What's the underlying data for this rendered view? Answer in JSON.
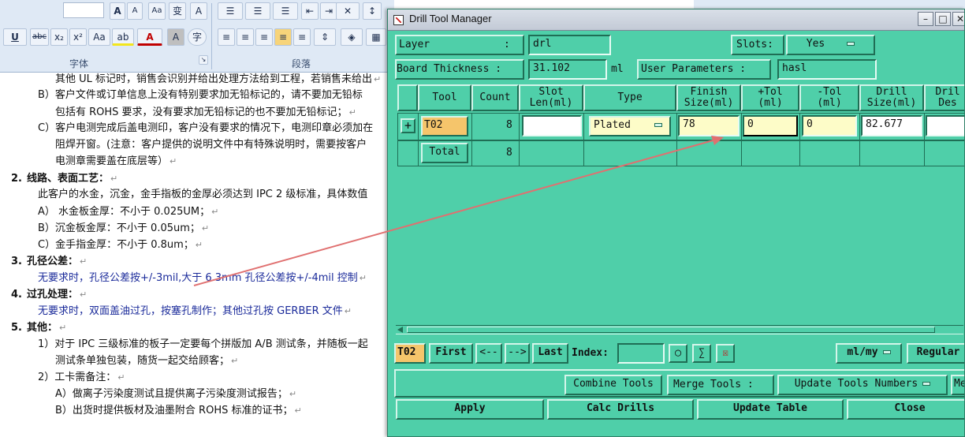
{
  "word": {
    "ribbon": {
      "row1_buttons": [
        "A",
        "A",
        "Aa",
        "变",
        "A"
      ],
      "row2_buttons": [
        "U",
        "abc",
        "x₂",
        "x²",
        "Aa",
        "ab",
        "A",
        "A",
        "字"
      ],
      "para_icons": [
        "☰",
        "☰",
        "☰",
        "⇤",
        "⇥",
        "✕",
        "↕"
      ],
      "group_font": "字体",
      "group_paragraph": "段落"
    },
    "doc_lines": [
      {
        "text": "其他 UL 标记时，销售会识别并给出处理方法给到工程，若销售未给出"
      },
      {
        "text": "B）客户文件或订单信息上没有特别要求加无铅标记的，请不要加无铅标"
      },
      {
        "text": "包括有 ROHS 要求，没有要求加无铅标记的也不要加无铅标记；"
      },
      {
        "text": "C）客户电测完成后盖电测印，客户没有要求的情况下，电测印章必须加在"
      },
      {
        "text": "阻焊开窗。(注意：客户提供的说明文件中有特殊说明时，需要按客户"
      },
      {
        "text": "电测章需要盖在底层等）"
      },
      {
        "num": "2.",
        "text": "线路、表面工艺："
      },
      {
        "text": "此客户的水金，沉金，金手指板的金厚必须达到 IPC 2 级标准，具体数值"
      },
      {
        "text": "A）      水金板金厚：不小于 0.025UM；"
      },
      {
        "text": "B）沉金板金厚：不小于 0.05um；"
      },
      {
        "text": "C）金手指金厚：不小于 0.8um；"
      },
      {
        "num": "3.",
        "text": "孔径公差："
      },
      {
        "text": "无要求时，孔径公差按+/-3mil,大于 6.3mm 孔径公差按+/-4mil 控制"
      },
      {
        "num": "4.",
        "text": "过孔处理："
      },
      {
        "text": "无要求时，双面盖油过孔，按塞孔制作；其他过孔按 GERBER 文件"
      },
      {
        "num": "5.",
        "text": "其他："
      },
      {
        "text": "1）对于 IPC 三级标准的板子一定要每个拼版加 A/B 测试条，并随板一起"
      },
      {
        "text": "测试条单独包装，随货一起交给顾客；"
      },
      {
        "text": "2）工卡需备注："
      },
      {
        "text": "A）做离子污染度测试且提供离子污染度测试报告；"
      },
      {
        "text": "B）出货时提供板材及油墨附合 ROHS 标准的证书；"
      }
    ]
  },
  "dtm": {
    "title": "Drill Tool Manager",
    "layer_label": "Layer            :",
    "layer_value": "drl",
    "slots_label": "Slots:",
    "slots_value": "Yes",
    "board_thickness_label": "Board Thickness :",
    "board_thickness_value": "31.102",
    "board_thickness_unit": "ml",
    "user_params_label": "User Parameters :",
    "user_params_value": "hasl",
    "headers": {
      "tool": "Tool",
      "count": "Count",
      "slot_len": "Slot\nLen(ml)",
      "type": "Type",
      "finish_size": "Finish\nSize(ml)",
      "plus_tol": "+Tol\n(ml)",
      "minus_tol": "-Tol\n(ml)",
      "drill_size": "Drill\nSize(ml)",
      "drill_desc": "Dril\nDes"
    },
    "rows": [
      {
        "tool": "T02",
        "count": "8",
        "slot_len": "",
        "type": "Plated",
        "finish_size": "78",
        "plus_tol": "0",
        "minus_tol": "0",
        "drill_size": "82.677",
        "drill_desc": ""
      }
    ],
    "total_label": "Total",
    "total_count": "8",
    "nav": {
      "current_tool": "T02",
      "first": "First",
      "prev": "<--",
      "next": "-->",
      "last": "Last",
      "index_label": "Index:",
      "units": "ml/my",
      "regular": "Regular"
    },
    "actions": {
      "combine": "Combine Tools",
      "merge": "Merge Tools :",
      "update_numbers": "Update Tools Numbers",
      "more": "Me"
    },
    "bottom": {
      "apply": "Apply",
      "calc": "Calc Drills",
      "update_table": "Update Table",
      "close": "Close"
    },
    "colors": {
      "panel": "#4fcfa9",
      "highlight": "#d4f5ea",
      "shadow": "#1f6e55",
      "tool_field": "#f5c56b",
      "entry_yellow": "#fdfcc8",
      "arrow": "#e07070"
    }
  }
}
